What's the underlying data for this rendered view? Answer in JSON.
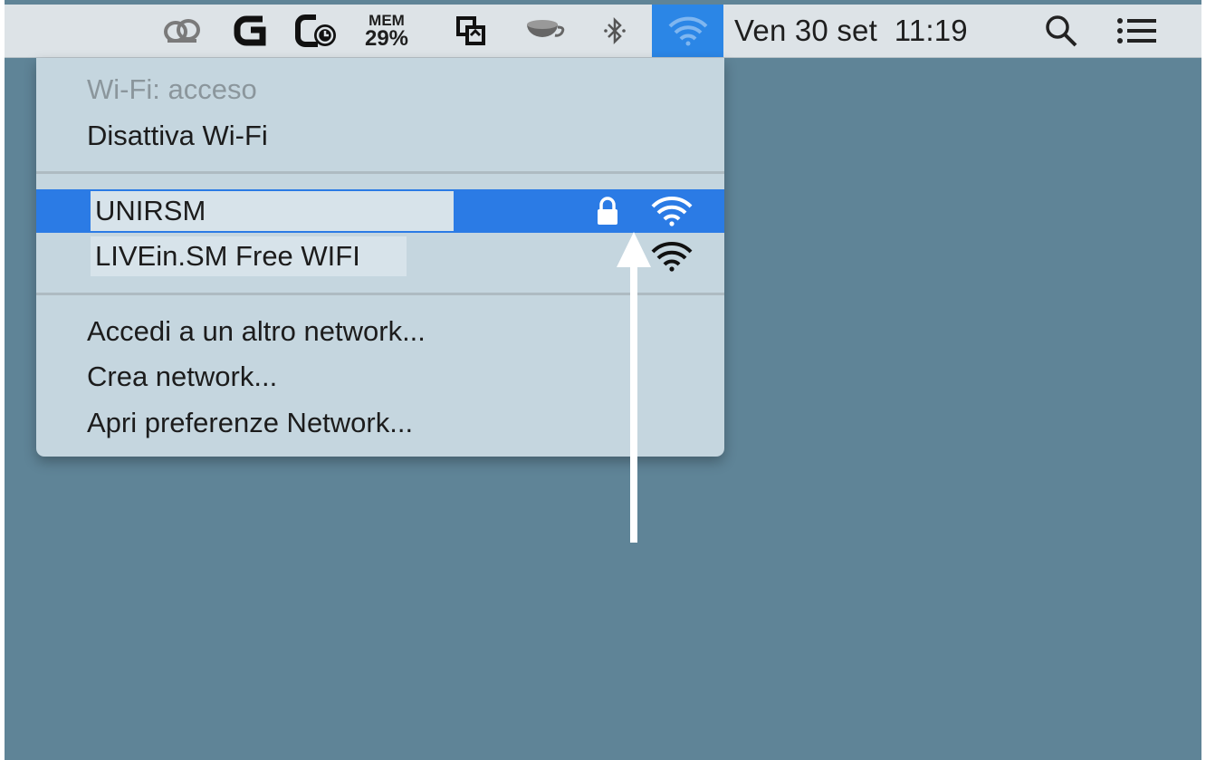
{
  "menubar": {
    "icons": [
      "creative-cloud-icon",
      "logitech-g-icon",
      "time-machine-icon",
      "memory-monitor-icon",
      "display-mirror-icon",
      "coffee-cup-icon",
      "bluetooth-icon",
      "wifi-icon",
      "spotlight-search-icon",
      "notification-center-icon"
    ],
    "mem_label": "MEM",
    "mem_value": "29%",
    "clock": "Ven 30 set  11:19",
    "accent_color": "#2b86e6"
  },
  "wifi_menu": {
    "status": "Wi-Fi: acceso",
    "toggle": "Disattiva Wi-Fi",
    "networks": [
      {
        "name": "UNIRSM",
        "locked": true,
        "selected": true
      },
      {
        "name": "LIVEin.SM Free WIFI",
        "locked": false,
        "selected": false
      }
    ],
    "actions": [
      {
        "label": "Accedi a un altro network..."
      },
      {
        "label": "Crea network..."
      },
      {
        "label": "Apri preferenze Network..."
      }
    ]
  },
  "colors": {
    "desktop": "#5f8497",
    "menu_background": "#c5d6df",
    "selection": "#2b7be5",
    "annotation_arrow": "#ffffff"
  }
}
